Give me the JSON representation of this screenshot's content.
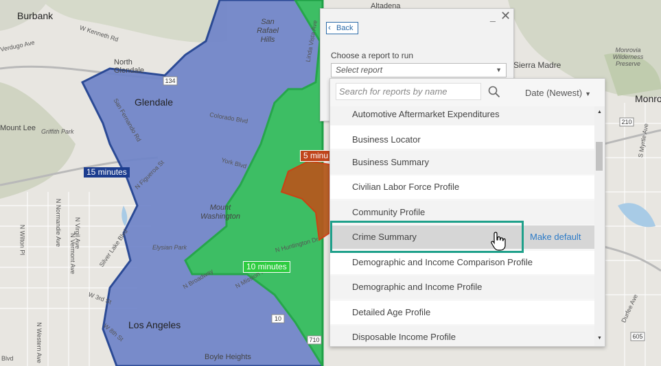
{
  "map": {
    "cities": [
      "Burbank",
      "Glendale",
      "Los Angeles",
      "Altadena",
      "Sierra Madre",
      "Monrovia Wilderness Preserve",
      "Monro",
      "Mount Lee",
      "North Glendale",
      "San Rafael Hills",
      "Mount Washington",
      "Boyle Heights",
      "Griffith Park",
      "Elysian Park"
    ],
    "streets": [
      "W Kenneth Rd",
      "Colorado Blvd",
      "San Fernando Rd",
      "Verdugo Ave",
      "N Broadway",
      "Silver Lake Blvd",
      "W 3rd St",
      "W 8th St",
      "N Western Ave",
      "N Vermont Ave",
      "N Normandie Ave",
      "N Virgil Ave",
      "N Wilton Pl",
      "S Myrtle Ave",
      "Durfee Ave",
      "N Mission Rd",
      "York Blvd",
      "N Figueroa St",
      "N Huntington Dr",
      "Linda Vista Ave",
      "Blvd"
    ],
    "shields": [
      "134",
      "210",
      "10",
      "710",
      "605"
    ],
    "drive_times": [
      {
        "label": "15 minutes",
        "color": "#1c3d8f"
      },
      {
        "label": "10 minutes",
        "color": "#2ecc40"
      },
      {
        "label": "5 minu",
        "color": "#c0441b"
      }
    ]
  },
  "panel": {
    "back_label": "Back",
    "minimize_label": "_",
    "close_label": "✕",
    "choose_label": "Choose a report to run",
    "select_placeholder": "Select report"
  },
  "dropdown": {
    "search_placeholder": "Search for reports by name",
    "sort_label": "Date (Newest)",
    "items": [
      "Automotive Aftermarket Expenditures",
      "Business Locator",
      "Business Summary",
      "Civilian Labor Force Profile",
      "Community Profile",
      "Crime Summary",
      "Demographic and Income Comparison Profile",
      "Demographic and Income Profile",
      "Detailed Age Profile",
      "Disposable Income Profile"
    ],
    "hovered_item": "Crime Summary",
    "make_default_label": "Make default"
  },
  "colors": {
    "accent": "#1ea08a",
    "link": "#2b7ac7",
    "drive15": "#6f84c9",
    "drive10": "#37c45a",
    "drive5": "#b4591e"
  }
}
